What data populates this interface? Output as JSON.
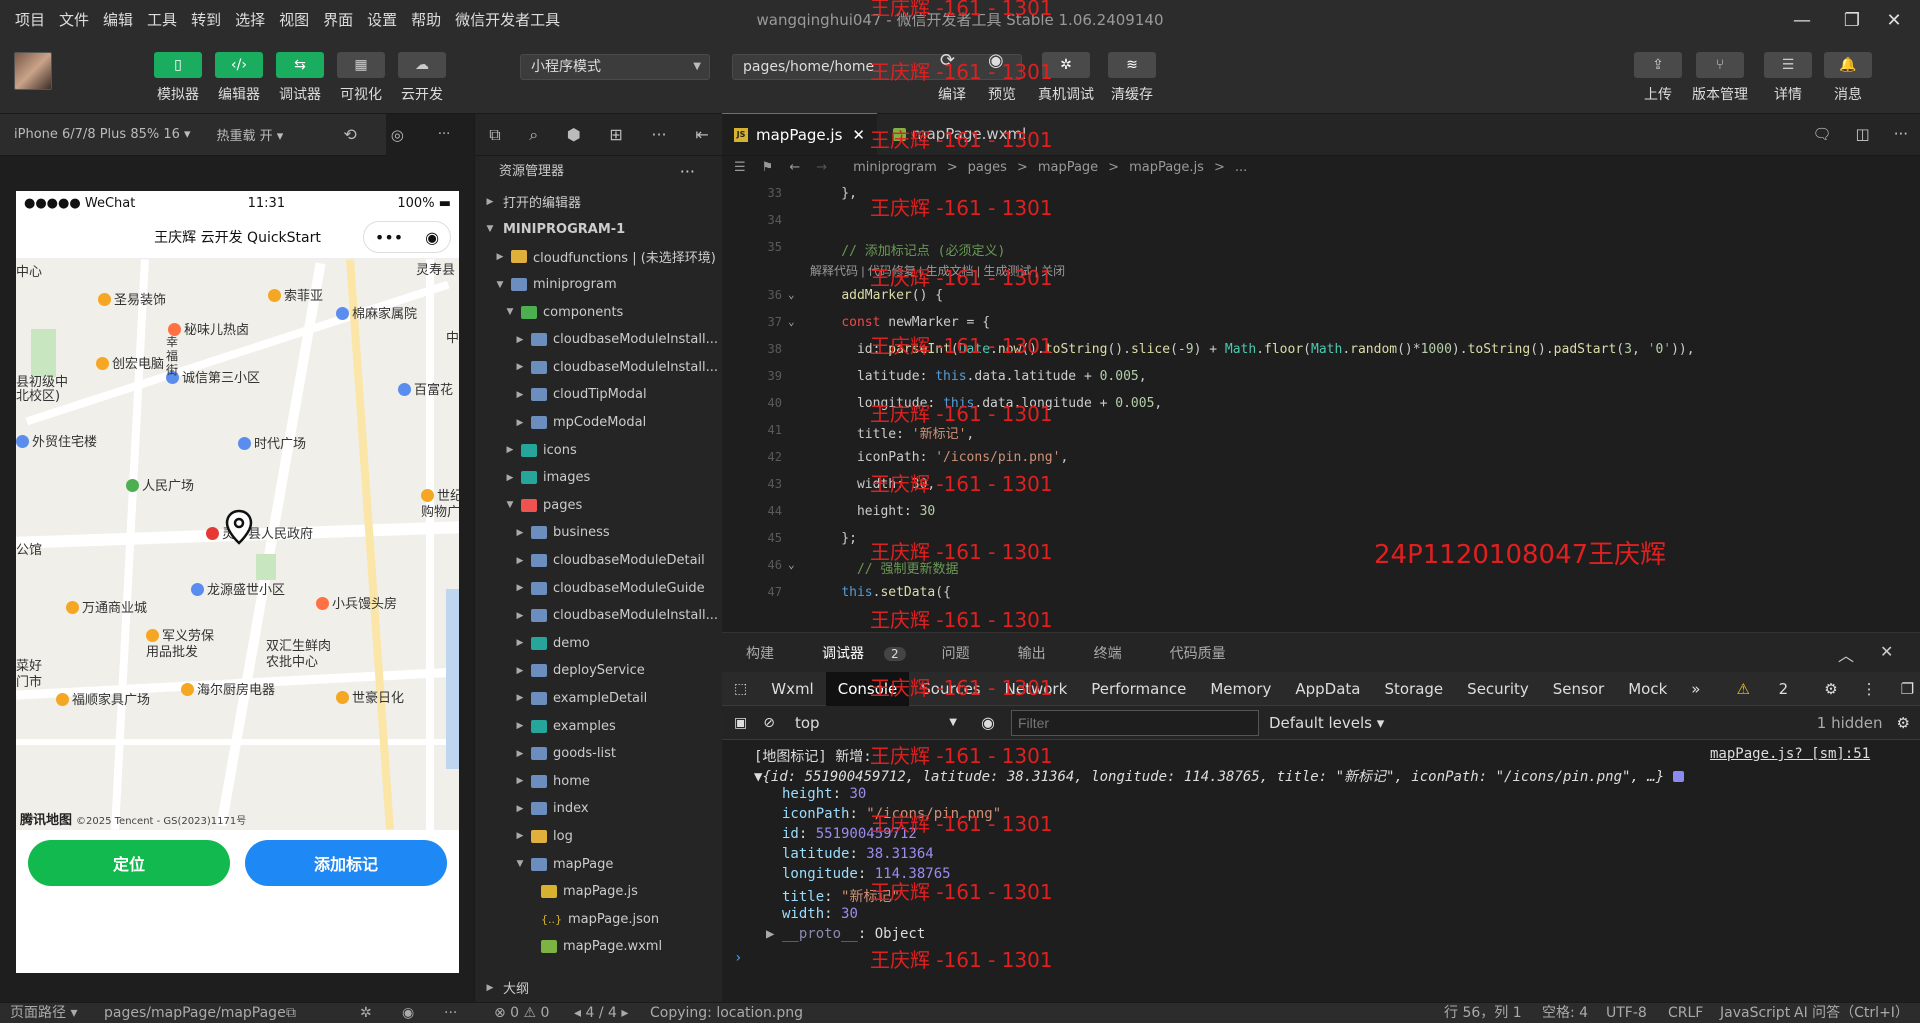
{
  "menubar": {
    "items": [
      "项目",
      "文件",
      "编辑",
      "工具",
      "转到",
      "选择",
      "视图",
      "界面",
      "设置",
      "帮助",
      "微信开发者工具"
    ],
    "title": "wangqinghui047 - 微信开发者工具 Stable 1.06.2409140"
  },
  "toolbar": {
    "left_buttons": [
      {
        "icon": "phone-icon",
        "label": "模拟器"
      },
      {
        "icon": "code-icon",
        "label": "编辑器"
      },
      {
        "icon": "sliders-icon",
        "label": "调试器"
      },
      {
        "icon": "layout-icon",
        "label": "可视化"
      },
      {
        "icon": "cloud-icon",
        "label": "云开发"
      }
    ],
    "mode_select": "小程序模式",
    "page_select": "pages/home/home",
    "mid_buttons": [
      {
        "icon": "refresh-icon",
        "label": "编译"
      },
      {
        "icon": "eye-icon",
        "label": "预览"
      },
      {
        "icon": "bug-icon",
        "label": "真机调试"
      },
      {
        "icon": "layers-icon",
        "label": "清缓存"
      }
    ],
    "right_buttons": [
      {
        "icon": "upload-icon",
        "label": "上传"
      },
      {
        "icon": "branch-icon",
        "label": "版本管理"
      },
      {
        "icon": "list-icon",
        "label": "详情"
      },
      {
        "icon": "bell-icon",
        "label": "消息"
      }
    ]
  },
  "simulator": {
    "device": "iPhone 6/7/8 Plus 85% 16 ▾",
    "hot_reload": "热重载 开 ▾",
    "status_left": "●●●●● WeChat",
    "status_time": "11:31",
    "status_battery": "100%",
    "nav_title": "王庆辉 云开发 QuickStart",
    "map_pois": [
      "中心",
      "圣易装饰",
      "索菲亚",
      "灵寿县",
      "秘味儿热卤",
      "棉麻家属院",
      "创宏电脑",
      "诚信第三小区",
      "县初级中",
      "北校区)",
      "百富花",
      "外贸住宅楼",
      "时代广场",
      "人民广场",
      "世纪润发",
      "购物广场",
      "灵寿县人民政府",
      "公馆",
      "龙源盛世小区",
      "小兵馒头房",
      "万通商业城",
      "军义劳保",
      "用品批发",
      "双汇生鲜肉",
      "农批中心",
      "海尔厨房电器",
      "世豪日化",
      "福顺家具广场",
      "中"
    ],
    "map_logo": "腾讯地图",
    "map_copyright": "©2025 Tencent - GS(2023)1171号",
    "btn_locate": "定位",
    "btn_add_marker": "添加标记",
    "street_labels": [
      "幸",
      "福",
      "街"
    ],
    "store_labels": [
      "菜好",
      "门市"
    ]
  },
  "explorer": {
    "title": "资源管理器",
    "open_editors": "打开的编辑器",
    "root": "MINIPROGRAM-1",
    "outline": "大纲",
    "items": [
      {
        "level": 1,
        "name": "cloudfunctions | (未选择环境)",
        "type": "folder-yellow",
        "open": false
      },
      {
        "level": 1,
        "name": "miniprogram",
        "type": "folder",
        "open": true
      },
      {
        "level": 2,
        "name": "components",
        "type": "folder-green",
        "open": true
      },
      {
        "level": 3,
        "name": "cloudbaseModuleInstall...",
        "type": "folder",
        "open": false
      },
      {
        "level": 3,
        "name": "cloudbaseModuleInstall...",
        "type": "folder",
        "open": false
      },
      {
        "level": 3,
        "name": "cloudTipModal",
        "type": "folder",
        "open": false
      },
      {
        "level": 3,
        "name": "mpCodeModal",
        "type": "folder",
        "open": false
      },
      {
        "level": 2,
        "name": "icons",
        "type": "folder-teal",
        "open": false
      },
      {
        "level": 2,
        "name": "images",
        "type": "folder-teal",
        "open": false
      },
      {
        "level": 2,
        "name": "pages",
        "type": "folder-red",
        "open": true
      },
      {
        "level": 3,
        "name": "business",
        "type": "folder",
        "open": false
      },
      {
        "level": 3,
        "name": "cloudbaseModuleDetail",
        "type": "folder",
        "open": false
      },
      {
        "level": 3,
        "name": "cloudbaseModuleGuide",
        "type": "folder",
        "open": false
      },
      {
        "level": 3,
        "name": "cloudbaseModuleInstall...",
        "type": "folder",
        "open": false
      },
      {
        "level": 3,
        "name": "demo",
        "type": "folder-teal",
        "open": false
      },
      {
        "level": 3,
        "name": "deployService",
        "type": "folder",
        "open": false
      },
      {
        "level": 3,
        "name": "exampleDetail",
        "type": "folder",
        "open": false
      },
      {
        "level": 3,
        "name": "examples",
        "type": "folder-teal",
        "open": false
      },
      {
        "level": 3,
        "name": "goods-list",
        "type": "folder",
        "open": false
      },
      {
        "level": 3,
        "name": "home",
        "type": "folder",
        "open": false
      },
      {
        "level": 3,
        "name": "index",
        "type": "folder",
        "open": false
      },
      {
        "level": 3,
        "name": "log",
        "type": "folder-yellow",
        "open": false
      },
      {
        "level": 3,
        "name": "mapPage",
        "type": "folder",
        "open": true
      },
      {
        "level": 4,
        "name": "mapPage.js",
        "type": "js"
      },
      {
        "level": 4,
        "name": "mapPage.json",
        "type": "json"
      },
      {
        "level": 4,
        "name": "mapPage.wxml",
        "type": "wxml"
      }
    ]
  },
  "editor": {
    "tabs": [
      {
        "label": "mapPage.js",
        "icon": "JS",
        "active": true
      },
      {
        "label": "mapPage.wxml",
        "icon": "wxml",
        "active": false
      }
    ],
    "breadcrumb": [
      "miniprogram",
      ">",
      "pages",
      ">",
      "mapPage",
      ">",
      "mapPage.js",
      ">",
      "..."
    ],
    "codelens": "解释代码 | 代码修复 | 生成文档 | 生成测试 | 关闭",
    "lines": [
      {
        "n": "33",
        "t": "    },"
      },
      {
        "n": "34",
        "t": ""
      },
      {
        "n": "35",
        "t": "    // 添加标记点 (必须定义)"
      },
      {
        "n": "36",
        "t": "    addMarker() {"
      },
      {
        "n": "37",
        "t": "    const newMarker = {"
      },
      {
        "n": "38",
        "t": "      id: parseInt(Date.now().toString().slice(-9) + Math.floor(Math.random()*1000).toString().padStart(3, '0')),"
      },
      {
        "n": "39",
        "t": "      latitude: this.data.latitude + 0.005,"
      },
      {
        "n": "40",
        "t": "      longitude: this.data.longitude + 0.005,"
      },
      {
        "n": "41",
        "t": "      title: '新标记',"
      },
      {
        "n": "42",
        "t": "      iconPath: '/icons/pin.png',"
      },
      {
        "n": "43",
        "t": "      width: 30,"
      },
      {
        "n": "44",
        "t": "      height: 30"
      },
      {
        "n": "45",
        "t": "    };"
      },
      {
        "n": "46",
        "t": "      // 强制更新数据"
      },
      {
        "n": "47",
        "t": "    this.setData({"
      }
    ]
  },
  "debugger": {
    "panel_tabs": [
      "构建",
      "调试器",
      "问题",
      "输出",
      "终端",
      "代码质量"
    ],
    "debug_badge": "2",
    "dev_tabs": [
      "Wxml",
      "Console",
      "Sources",
      "Network",
      "Performance",
      "Memory",
      "AppData",
      "Storage",
      "Security",
      "Sensor",
      "Mock",
      "»"
    ],
    "warn_count": "2",
    "context": "top",
    "filter_placeholder": "Filter",
    "levels": "Default levels ▾",
    "hidden": "1 hidden",
    "console": {
      "log_title": "[地图标记] 新增:",
      "source": "mapPage.js? [sm]:51",
      "summary": "{id: 551900459712, latitude: 38.31364, longitude: 114.38765, title: \"新标记\", iconPath: \"/icons/pin.png\", …}",
      "props": [
        {
          "k": "height",
          "v": "30"
        },
        {
          "k": "iconPath",
          "v": "\"/icons/pin.png\""
        },
        {
          "k": "id",
          "v": "551900459712"
        },
        {
          "k": "latitude",
          "v": "38.31364"
        },
        {
          "k": "longitude",
          "v": "114.38765"
        },
        {
          "k": "title",
          "v": "\"新标记\""
        },
        {
          "k": "width",
          "v": "30"
        },
        {
          "k": "__proto__",
          "v": "Object"
        }
      ]
    }
  },
  "statusbar": {
    "page_path_label": "页面路径 ▾",
    "page_path": "pages/mapPage/mapPage",
    "errors": "⊗ 0 ⚠ 0",
    "pager": "◂ 4 / 4 ▸",
    "copying": "Copying: location.png",
    "position": "行 56，列 1",
    "spaces": "空格: 4",
    "encoding": "UTF-8",
    "eol": "CRLF",
    "lang": "JavaScript",
    "ai": "AI 问答（Ctrl+I）"
  },
  "watermark": {
    "repeat": "王庆辉 -161 - 1301",
    "big": "24P1120108047王庆辉"
  },
  "colors": {
    "accent": "#1aad5f",
    "blue": "#1e88f5",
    "watermark": "#e02020"
  }
}
